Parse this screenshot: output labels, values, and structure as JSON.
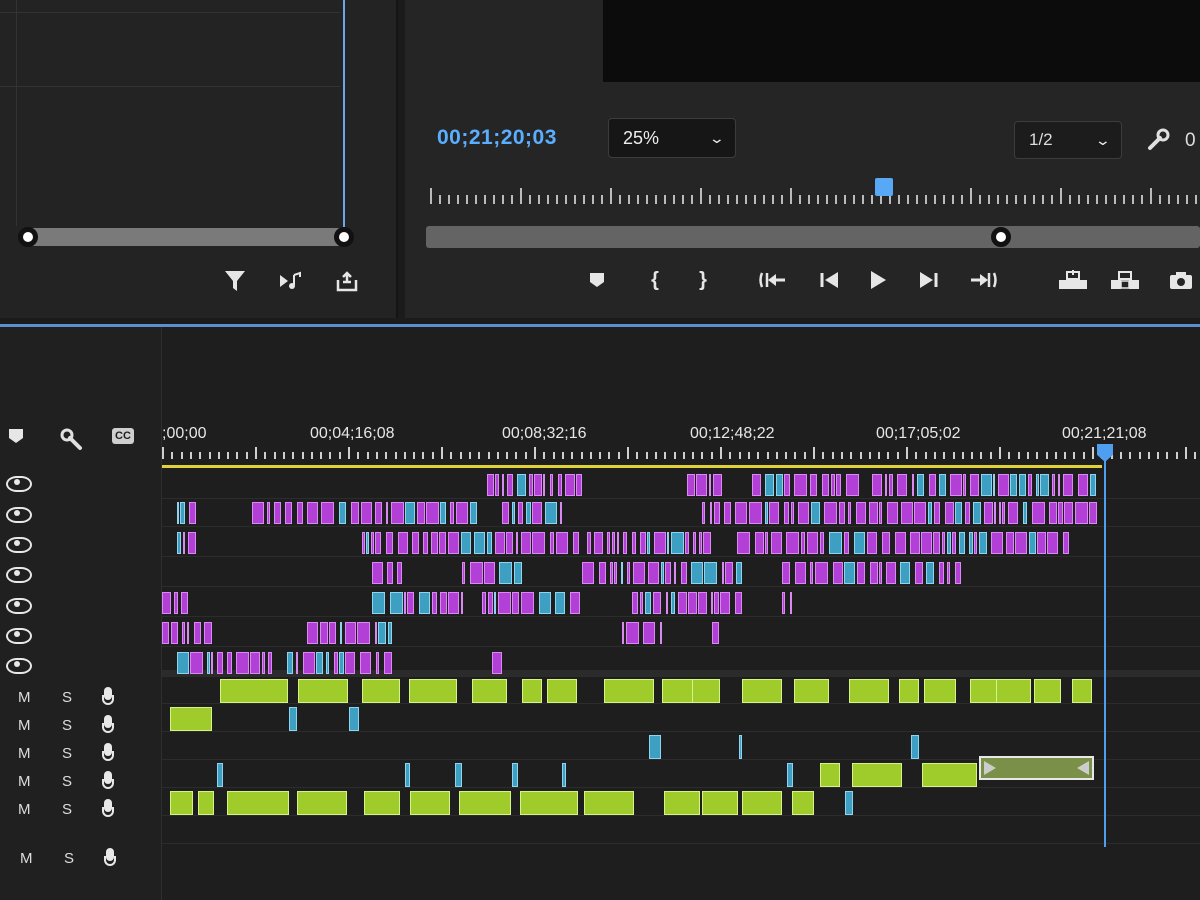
{
  "program": {
    "timecode": "00;21;20;03",
    "zoom_value": "25%",
    "resolution_value": "1/2",
    "extra_label": "0"
  },
  "timeline": {
    "ruler_labels": [
      ";00;00",
      "00;04;16;08",
      "00;08;32;16",
      "00;12;48;22",
      "00;17;05;02",
      "00;21;21;08"
    ],
    "cc_label": "CC",
    "video_track_count": 7,
    "audio_tracks": [
      {
        "mute": "M",
        "solo": "S"
      },
      {
        "mute": "M",
        "solo": "S"
      },
      {
        "mute": "M",
        "solo": "S"
      },
      {
        "mute": "M",
        "solo": "S"
      },
      {
        "mute": "M",
        "solo": "S"
      },
      {
        "mute": "M",
        "solo": "S"
      }
    ]
  },
  "colors": {
    "accent": "#5aaeff",
    "video_clip": "#b23fd6",
    "cyan_clip": "#3d9fc2",
    "audio_clip": "#9fcc2a",
    "work_area": "#e0d33a"
  },
  "icons": {
    "source_tools": [
      "filter-icon",
      "insert-audio-icon",
      "export-icon"
    ],
    "program_controls": [
      "add-marker-icon",
      "mark-in-icon",
      "mark-out-icon",
      "go-to-in-icon",
      "step-back-icon",
      "play-icon",
      "step-forward-icon",
      "go-to-out-icon",
      "lift-icon",
      "extract-icon",
      "export-frame-icon"
    ]
  }
}
